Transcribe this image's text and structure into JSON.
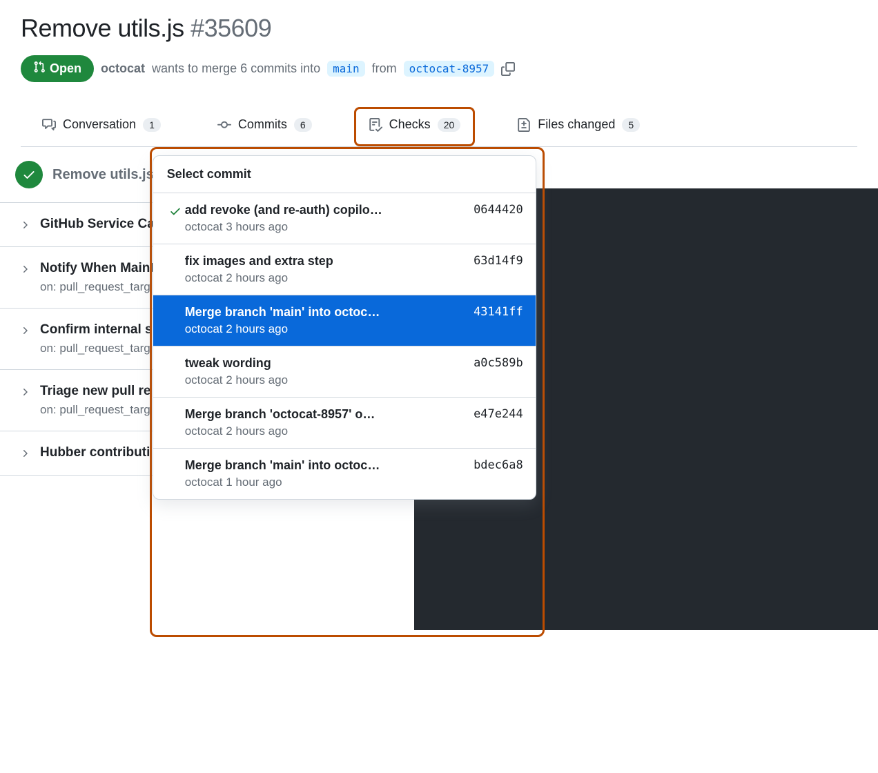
{
  "pr": {
    "title": "Remove utils.js",
    "number": "#35609",
    "state": "Open",
    "author": "octocat",
    "merge_text_1": "wants to merge 6 commits into",
    "base_branch": "main",
    "merge_text_2": "from",
    "head_branch": "octocat-8957"
  },
  "tabs": {
    "conversation": {
      "label": "Conversation",
      "count": "1"
    },
    "commits": {
      "label": "Commits",
      "count": "6"
    },
    "checks": {
      "label": "Checks",
      "count": "20"
    },
    "files": {
      "label": "Files changed",
      "count": "5"
    }
  },
  "checks_panel": {
    "title": "Remove utils.js",
    "current_sha": "0644420"
  },
  "workflows": [
    {
      "name": "GitHub Service Ca",
      "sub": ""
    },
    {
      "name": "Notify When Maint",
      "sub": "on: pull_request_targ"
    },
    {
      "name": "Confirm internal s",
      "sub": "on: pull_request_targ"
    },
    {
      "name": "Triage new pull re",
      "sub": "on: pull_request_targ"
    },
    {
      "name": "Hubber contributi",
      "sub": ""
    }
  ],
  "dropdown": {
    "header": "Select commit",
    "items": [
      {
        "title": "add revoke (and re-auth) copilo…",
        "sub": "octocat 3 hours ago",
        "sha": "0644420",
        "checked": true,
        "selected": false
      },
      {
        "title": "fix images and extra step",
        "sub": "octocat 2 hours ago",
        "sha": "63d14f9",
        "checked": false,
        "selected": false
      },
      {
        "title": "Merge branch 'main' into octoc…",
        "sub": "octocat 2 hours ago",
        "sha": "43141ff",
        "checked": false,
        "selected": true
      },
      {
        "title": "tweak wording",
        "sub": "octocat 2 hours ago",
        "sha": "a0c589b",
        "checked": false,
        "selected": false
      },
      {
        "title": "Merge branch 'octocat-8957' o…",
        "sub": "octocat 2 hours ago",
        "sha": "e47e244",
        "checked": false,
        "selected": false
      },
      {
        "title": "Merge branch 'main' into octoc…",
        "sub": "octocat 1 hour ago",
        "sha": "bdec6a8",
        "checked": false,
        "selected": false
      }
    ]
  }
}
